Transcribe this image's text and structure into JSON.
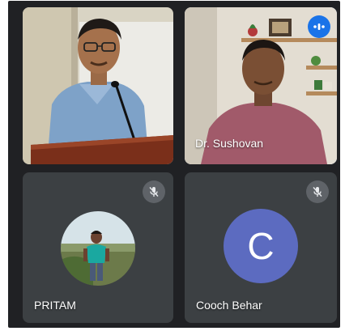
{
  "participants": [
    {
      "name": ""
    },
    {
      "name": "Dr. Sushovan"
    },
    {
      "name": "PRITAM",
      "muted": true
    },
    {
      "name": "Cooch Behar",
      "initial": "C",
      "avatar_color": "#5c6bc0",
      "muted": true
    }
  ],
  "colors": {
    "background": "#202124",
    "tile": "#3c4043",
    "active_border": "#8ab4f8",
    "speaking_indicator": "#1a73e8",
    "mute_badge": "#5f6368"
  },
  "icons": {
    "mute": "mic-off-icon",
    "speaking": "audio-levels-icon"
  }
}
